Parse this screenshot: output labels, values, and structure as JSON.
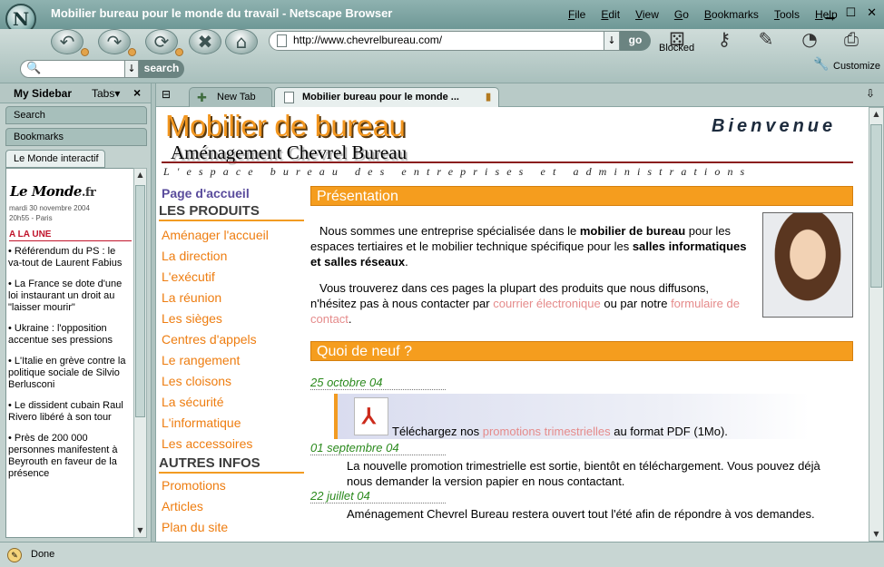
{
  "window": {
    "title": "Mobilier bureau pour le monde du travail - Netscape Browser",
    "menu": [
      "File",
      "Edit",
      "View",
      "Go",
      "Bookmarks",
      "Tools",
      "Help"
    ]
  },
  "toolbar": {
    "url": "http://www.chevrelbureau.com/",
    "go_label": "go",
    "search_label": "search",
    "blocked_label": "Blocked",
    "customize_label": "Customize"
  },
  "sidebar": {
    "title": "My Sidebar",
    "tabs_label": "Tabs",
    "panels": [
      "Search",
      "Bookmarks",
      "Le Monde interactif"
    ],
    "lemonde": {
      "logo": "Le Monde",
      "logo_suffix": ".fr",
      "date": "mardi 30 novembre 2004",
      "time": "20h55 - Paris",
      "section": "A LA UNE",
      "items": [
        "• Référendum du PS : le va-tout de Laurent Fabius",
        "• La France se dote d'une loi instaurant un droit au \"laisser mourir\"",
        "• Ukraine : l'opposition accentue ses pressions",
        "• L'Italie en grève contre la politique sociale de Silvio Berlusconi",
        "• Le dissident cubain Raul Rivero libéré à son tour",
        "• Près de 200 000 personnes manifestent à Beyrouth en faveur de la présence"
      ]
    }
  },
  "tabs": [
    {
      "label": "New Tab"
    },
    {
      "label": "Mobilier bureau pour le monde ..."
    }
  ],
  "page": {
    "brand": "Mobilier de bureau",
    "brand_sub": "Aménagement Chevrel Bureau",
    "welcome": "Bienvenue",
    "tagline": "L'espace bureau des entreprises et administrations",
    "nav": {
      "home": "Page d'accueil",
      "products_heading": "LES PRODUITS",
      "products": [
        "Aménager l'accueil",
        "La direction",
        "L'exécutif",
        "La réunion",
        "Les sièges",
        "Centres d'appels",
        "Le rangement",
        "Les cloisons",
        "La sécurité",
        "L'informatique",
        "Les accessoires"
      ],
      "other_heading": "AUTRES INFOS",
      "other": [
        "Promotions",
        "Articles",
        "Plan du site"
      ]
    },
    "presentation": {
      "heading": "Présentation",
      "p1_a": "Nous sommes une entreprise spécialisée dans le ",
      "p1_b": "mobilier de bureau",
      "p1_c": " pour les espaces tertiaires et le mobilier technique spécifique pour les ",
      "p1_d": "salles informatiques et salles réseaux",
      "p1_e": ".",
      "p2_a": "Vous trouverez dans ces pages la plupart des produits que nous diffusons, n'hésitez pas à nous contacter par ",
      "p2_link1": "courrier électronique",
      "p2_b": " ou par notre ",
      "p2_link2": "formulaire de contact",
      "p2_c": "."
    },
    "news": {
      "heading": "Quoi de neuf ?",
      "items": [
        {
          "date": "25 octobre 04",
          "text_a": "Téléchargez nos ",
          "link": "promotions trimestrielles",
          "text_b": " au format PDF (1Mo)."
        },
        {
          "date": "01 septembre 04",
          "text": "La nouvelle promotion trimestrielle est sortie, bientôt en téléchargement. Vous pouvez déjà nous demander la version papier en nous contactant."
        },
        {
          "date": "22 juillet 04",
          "text": "Aménagement Chevrel Bureau restera ouvert tout l'été afin de répondre à vos demandes."
        }
      ]
    }
  },
  "status": {
    "text": "Done"
  },
  "colors": {
    "orange": "#f59d1e",
    "nav_link": "#ee7d10",
    "bordeaux": "#8a1e1e",
    "news_date": "#2b8a1d",
    "pink_link": "#e58b8b"
  }
}
